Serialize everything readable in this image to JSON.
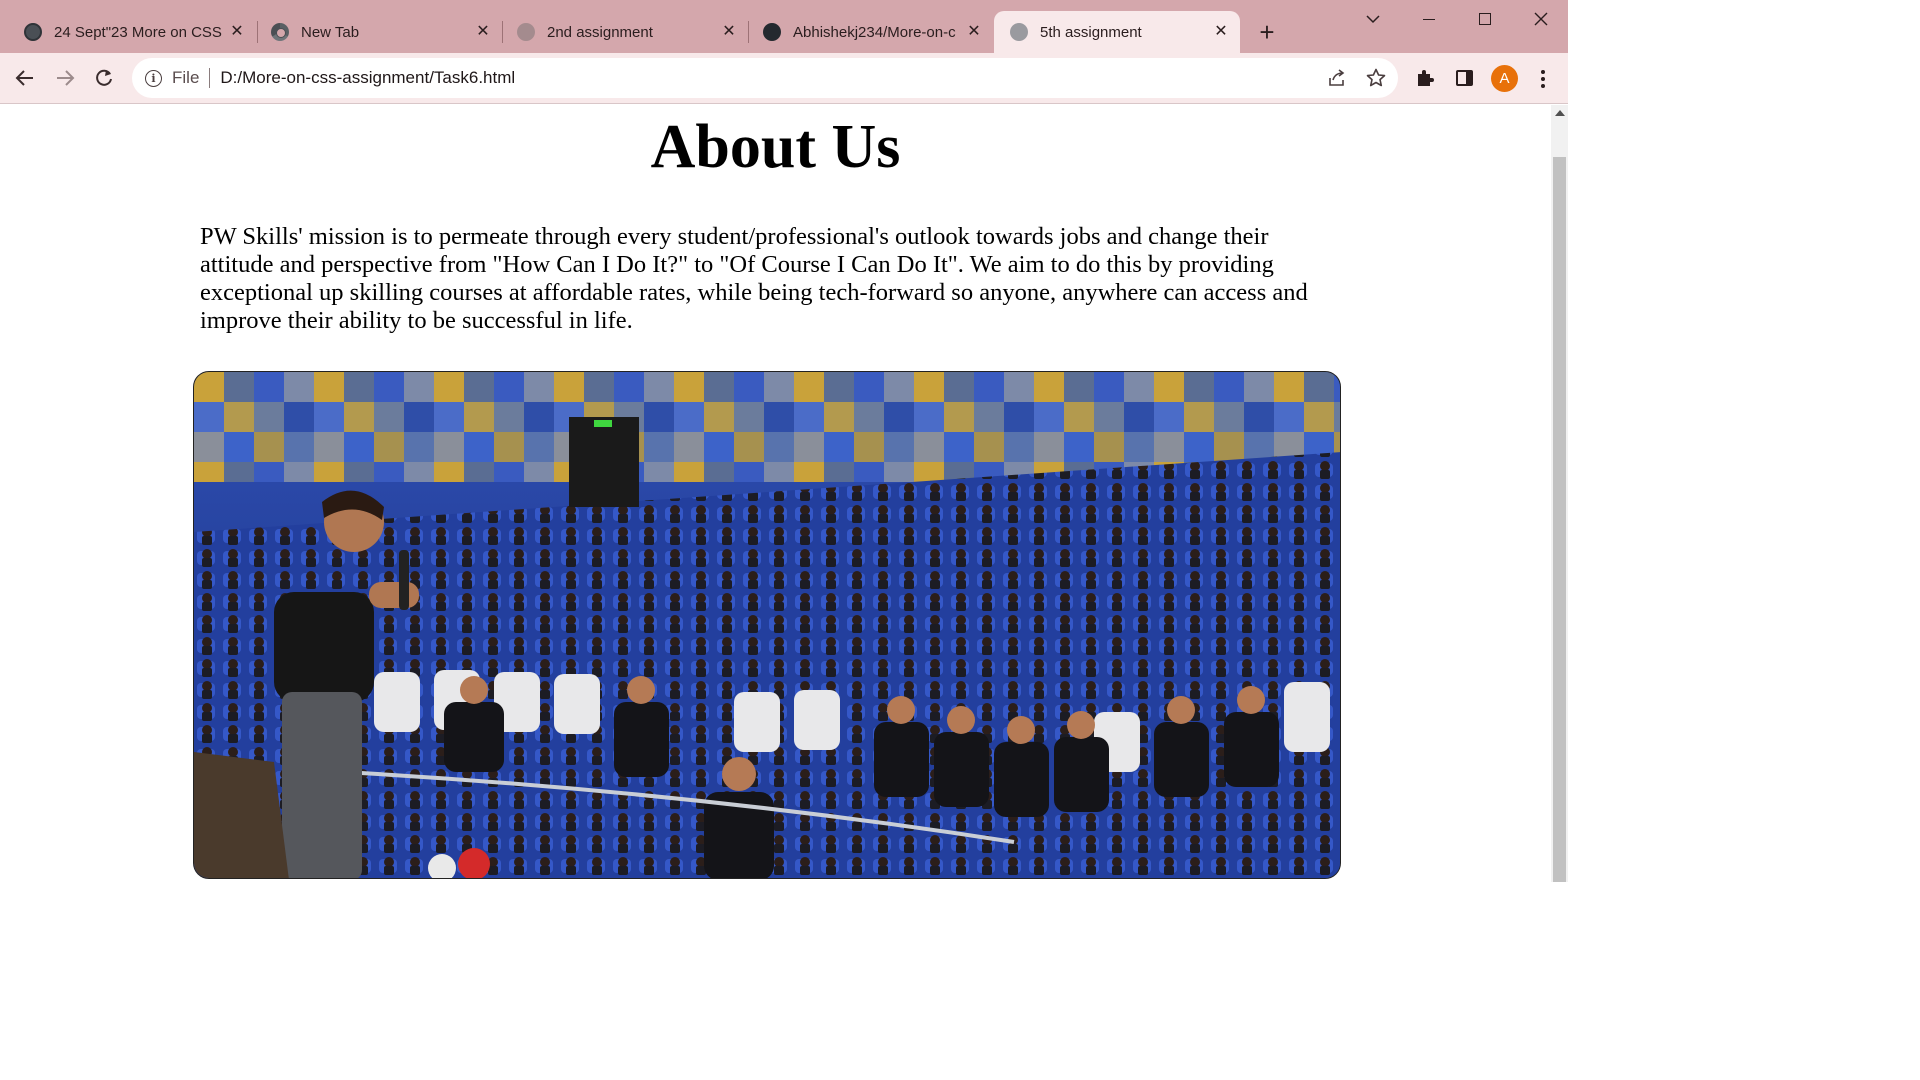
{
  "browser": {
    "tabs": [
      {
        "title": "24 Sept\"23 More on CSS",
        "icon": "wordpress-icon",
        "active": false
      },
      {
        "title": "New Tab",
        "icon": "chrome-icon",
        "active": false
      },
      {
        "title": "2nd assignment",
        "icon": "globe-icon",
        "active": false
      },
      {
        "title": "Abhishekj234/More-on-c",
        "icon": "github-icon",
        "active": false
      },
      {
        "title": "5th assignment",
        "icon": "globe-icon",
        "active": true
      }
    ],
    "new_tab_glyph": "+",
    "close_glyph": "✕",
    "address": {
      "scheme_label": "File",
      "url": "D:/More-on-css-assignment/Task6.html"
    },
    "profile_initial": "A",
    "colors": {
      "titlebar": "#d4a7ac",
      "toolbar": "#f8e9ea",
      "avatar": "#e8710a"
    }
  },
  "page": {
    "heading": "About Us",
    "paragraph": "PW Skills' mission is to permeate through every student/professional's outlook towards jobs and change their attitude and perspective from \"How Can I Do It?\" to \"Of Course I Can Do It\". We aim to do this by providing exceptional up skilling courses at affordable rates, while being tech-forward so anyone, anywhere can access and improve their ability to be successful in life.",
    "hero_image": "auditorium-speaker-photo"
  }
}
